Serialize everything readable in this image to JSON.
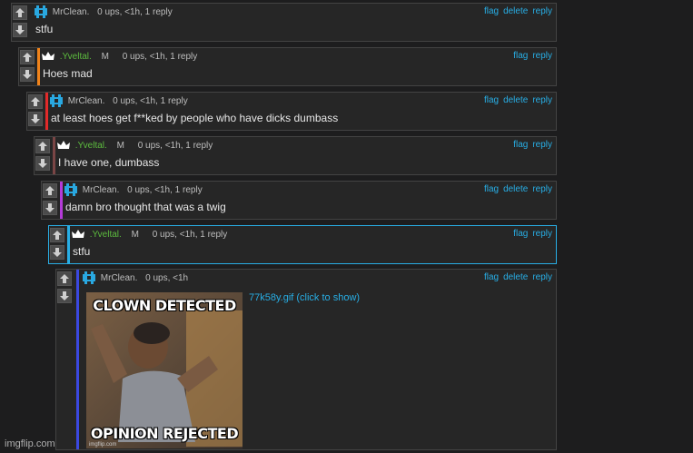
{
  "actions": {
    "flag": "flag",
    "delete": "delete",
    "reply": "reply"
  },
  "comments": [
    {
      "user": "MrClean.",
      "user_icon": "mrclean-icon",
      "mod": "",
      "meta": "0 ups, <1h, 1 reply",
      "text": "stfu",
      "bar_color": ""
    },
    {
      "user": ".Yveltal.",
      "user_icon": "crown-icon",
      "mod": "M",
      "meta": "0 ups, <1h, 1 reply",
      "text": "Hoes mad",
      "bar_color": "#f0831a"
    },
    {
      "user": "MrClean.",
      "user_icon": "mrclean-icon",
      "mod": "",
      "meta": "0 ups, <1h, 1 reply",
      "text": "at least hoes get f**ked by people who have dicks dumbass",
      "bar_color": "#e22a2a"
    },
    {
      "user": ".Yveltal.",
      "user_icon": "crown-icon",
      "mod": "M",
      "meta": "0 ups, <1h, 1 reply",
      "text": "I have one, dumbass",
      "bar_color": "#7a4545"
    },
    {
      "user": "MrClean.",
      "user_icon": "mrclean-icon",
      "mod": "",
      "meta": "0 ups, <1h, 1 reply",
      "text": "damn bro thought that was a twig",
      "bar_color": "#b43bd8"
    },
    {
      "user": ".Yveltal.",
      "user_icon": "crown-icon",
      "mod": "M",
      "meta": "0 ups, <1h, 1 reply",
      "text": "stfu",
      "bar_color": "#28aee5"
    },
    {
      "user": "MrClean.",
      "user_icon": "mrclean-icon",
      "mod": "",
      "meta": "0 ups, <1h",
      "text": "",
      "bar_color": "#3b48e0"
    }
  ],
  "meme": {
    "top_text": "CLOWN DETECTED",
    "bottom_text": "OPINION REJECTED",
    "watermark": "imgflip.com",
    "link_text": "77k58y.gif (click to show)"
  },
  "footer": "imgflip.com",
  "colors": {
    "link": "#28aee5",
    "username_mod": "#5cbb3e",
    "mrclean_icon": "#29a8e0",
    "background": "#1d1d1e",
    "panel": "#262626"
  }
}
